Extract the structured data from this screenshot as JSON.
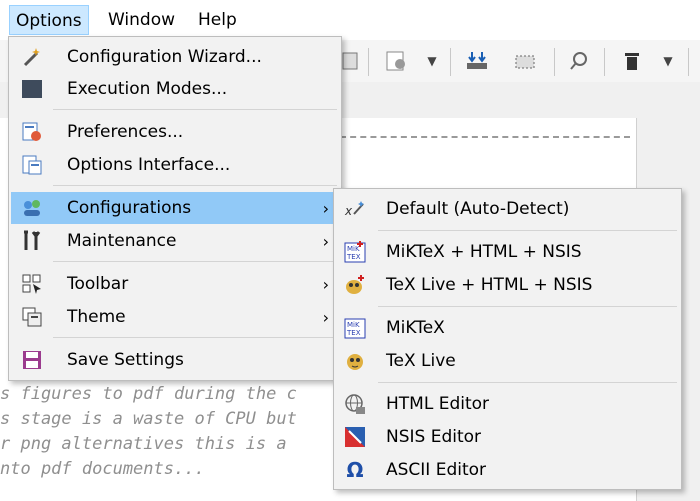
{
  "menubar": {
    "items": [
      {
        "label": "Options"
      },
      {
        "label": "Window"
      },
      {
        "label": "Help"
      }
    ]
  },
  "options_menu": {
    "items": [
      {
        "label": "Configuration Wizard...",
        "icon": "wand-icon"
      },
      {
        "label": "Execution Modes...",
        "icon": "square-icon"
      },
      {
        "label": "Preferences...",
        "icon": "preferences-icon"
      },
      {
        "label": "Options Interface...",
        "icon": "options-interface-icon"
      },
      {
        "label": "Configurations",
        "icon": "configurations-icon"
      },
      {
        "label": "Maintenance",
        "icon": "tools-icon"
      },
      {
        "label": "Toolbar",
        "icon": "toolbar-icon"
      },
      {
        "label": "Theme",
        "icon": "theme-icon"
      },
      {
        "label": "Save Settings",
        "icon": "save-icon"
      }
    ]
  },
  "configurations_menu": {
    "items": [
      {
        "label": "Default (Auto-Detect)",
        "icon": "auto-detect-icon"
      },
      {
        "label": "MiKTeX + HTML + NSIS",
        "icon": "miktex-plus-icon"
      },
      {
        "label": "TeX Live + HTML + NSIS",
        "icon": "texlive-plus-icon"
      },
      {
        "label": "MiKTeX",
        "icon": "miktex-icon"
      },
      {
        "label": "TeX Live",
        "icon": "texlive-icon"
      },
      {
        "label": "HTML Editor",
        "icon": "globe-icon"
      },
      {
        "label": "NSIS Editor",
        "icon": "nsis-icon"
      },
      {
        "label": "ASCII Editor",
        "icon": "omega-icon"
      }
    ]
  },
  "editor": {
    "lines": [
      "s figures to pdf during the c",
      "s stage is a waste of CPU but",
      "r png alternatives this is a",
      "nto pdf documents..."
    ]
  },
  "colors": {
    "highlight": "#91c9f7",
    "menu_bg": "#f2f2f2",
    "menubar_active": "#cce8ff"
  }
}
